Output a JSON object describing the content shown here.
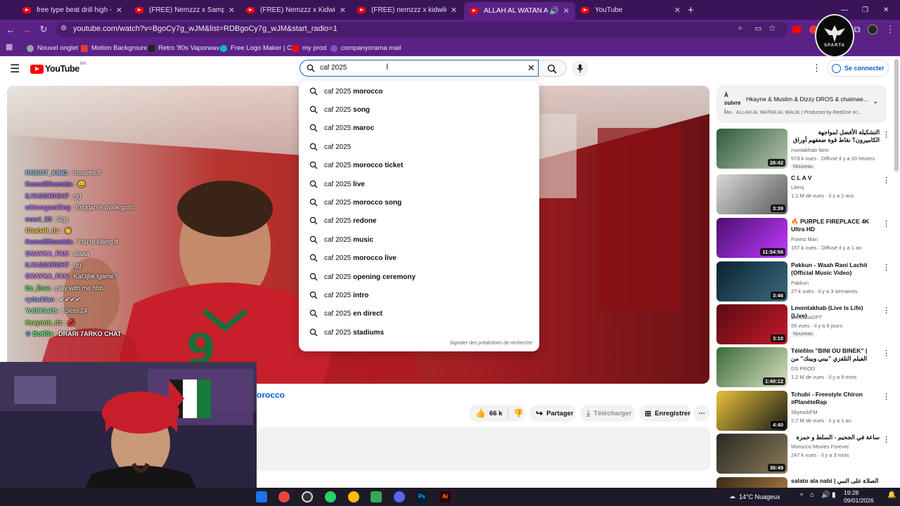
{
  "tabs": [
    {
      "label": "free type beat drill high - YouTube",
      "active": false
    },
    {
      "label": "(FREE) Nemzzz x Sample x Hoody",
      "active": false
    },
    {
      "label": "(FREE) Nemzzz x Kidwild x Hoody",
      "active": false
    },
    {
      "label": "(FREE) nemzzz x kidwild type bea",
      "active": false
    },
    {
      "label": "ALLAH AL WATAN AL MALIK",
      "active": true
    },
    {
      "label": "YouTube",
      "active": false
    }
  ],
  "toolbar": {
    "url": "youtube.com/watch?v=BgoCy7g_wJM&list=RDBgoCy7g_wJM&start_radio=1",
    "icons": [
      "back-icon",
      "forward-icon",
      "reload-icon",
      "site-info-icon",
      "zoom-icon",
      "install-icon",
      "bookmark-star-icon",
      "extensions-icon",
      "profile-icon",
      "menu-icon"
    ]
  },
  "bookmarks": [
    {
      "label": "Nouvel onglet",
      "color": "#9aa0a6"
    },
    {
      "label": "Motion Background",
      "color": "#e53935"
    },
    {
      "label": "Retro '80s Vaporwav...",
      "color": "#222222"
    },
    {
      "label": "Free Logo Maker | C...",
      "color": "#00bcd4"
    },
    {
      "label": "my prod",
      "color": "#ff0000"
    },
    {
      "label": "companyorama mail",
      "color": "#7e57c2"
    }
  ],
  "overlay_badge": "SPARTA",
  "yt": {
    "logo": "YouTube",
    "region": "MA",
    "search_value": "caf 2025",
    "signin": "Se connecter",
    "accent": "#065fd4"
  },
  "suggestions": [
    {
      "prefix": "caf 2025",
      "suffix": " morocco"
    },
    {
      "prefix": "caf 2025",
      "suffix": " song"
    },
    {
      "prefix": "caf 2025",
      "suffix": " maroc"
    },
    {
      "prefix": "caf 2025",
      "suffix": ""
    },
    {
      "prefix": "caf 2025",
      "suffix": " morocco ticket"
    },
    {
      "prefix": "caf 2025",
      "suffix": " live"
    },
    {
      "prefix": "caf 2025",
      "suffix": " morocco song"
    },
    {
      "prefix": "caf 2025",
      "suffix": " redone"
    },
    {
      "prefix": "caf 2025",
      "suffix": " music"
    },
    {
      "prefix": "caf 2025",
      "suffix": " morocco live"
    },
    {
      "prefix": "caf 2025",
      "suffix": " opening ceremony"
    },
    {
      "prefix": "caf 2025",
      "suffix": " intro"
    },
    {
      "prefix": "caf 2025",
      "suffix": " en direct"
    },
    {
      "prefix": "caf 2025",
      "suffix": " stadiums"
    }
  ],
  "suggest_footer": "Signaler des prédictions de recherche",
  "chat": [
    {
      "user": "ROBOT_KING",
      "msg": "!roulette 8",
      "color": "#9ad0ff"
    },
    {
      "user": "KemalElhamida",
      "msg": "😀",
      "color": "#a070ff"
    },
    {
      "user": "ILYASSXRGH7",
      "msg": "gg",
      "color": "#b07dff"
    },
    {
      "user": "ultimogamiiing",
      "msg": "Endgame dyalk gold.",
      "color": "#c27dff"
    },
    {
      "user": "nouri_93",
      "msg": "Ggs",
      "color": "#8f8fff"
    },
    {
      "user": "Chaball_dz",
      "msg": "👏",
      "color": "#ffd24d"
    },
    {
      "user": "KemalElhamida",
      "msg": "You're killing It",
      "color": "#a070ff"
    },
    {
      "user": "SMAYKA_FAN",
      "msg": "alaaa",
      "color": "#c88aff"
    },
    {
      "user": "ILYASSXRGH7",
      "msg": "gg",
      "color": "#b07dff"
    },
    {
      "user": "SMAYKA_FAN",
      "msg": "Kat3jbk lgame?",
      "color": "#c88aff"
    },
    {
      "user": "Dz_Eraa",
      "msg": "play with me hbb",
      "color": "#5cff5c"
    },
    {
      "user": "rydarkfan",
      "msg": "✔✔✔✔",
      "color": "#8fa8ff"
    },
    {
      "user": "YoDiiGaUs",
      "msg": "!Slots 24",
      "color": "#7dffb0"
    },
    {
      "user": "itsayoub_dz",
      "msg": "💋",
      "color": "#a7e85c"
    },
    {
      "user": "BotRix",
      "msg": "DRARI 7ARKO CHAT",
      "color": "#5cff7a"
    }
  ],
  "video": {
    "title_fragment": "orocco"
  },
  "actions": {
    "likes": "66 k",
    "share": "Partager",
    "download": "Télécharger",
    "save": "Enregistrer"
  },
  "upnext": {
    "label": "À suivre :",
    "title": "Hkayne & Muslim & Dizzy DROS & chaimae...",
    "subtitle": "Mix - ALLAH AL WATAN AL MALIK | Produced by RedOne #c..."
  },
  "recs": [
    {
      "title": "التشكيلة الأفضل لمواجهة الكاميرون؟ نقاط قوة ضعفهم أوراق دخرجوهم و دورو!؟",
      "channel": "montakhab fans",
      "stats": "579 k vues · Diffusé il y a 20 heures",
      "badge": "Nouveau",
      "duration": "28:42",
      "c1": "#2e5a3a",
      "c2": "#b8c7b0"
    },
    {
      "title": "C L A V",
      "channel": "Lbenj",
      "stats": "1,1 M de vues · il y a 2 ans",
      "badge": "",
      "duration": "3:39",
      "c1": "#d9d9d9",
      "c2": "#5a5a5a"
    },
    {
      "title": "🔥 PURPLE FIREPLACE 4K Ultra HD",
      "channel": "Forest Man",
      "stats": "157 k vues · Diffusé il y a 1 an",
      "badge": "",
      "duration": "11:54:56",
      "c1": "#4a0f6e",
      "c2": "#c23cff"
    },
    {
      "title": "Pakkun - Waah Rani Lachit (Official Music Video)",
      "channel": "Pakkun",
      "stats": "27 k vues · il y a 3 semaines",
      "badge": "",
      "duration": "3:46",
      "c1": "#0a2230",
      "c2": "#3a6b7e"
    },
    {
      "title": "Lmontakhab (Live Is Life) (Live)",
      "channel": "MoroccoGPT",
      "stats": "56 vues · il y a 6 jours",
      "badge": "Nouveau",
      "duration": "3:10",
      "c1": "#5a0a12",
      "c2": "#c21a2a"
    },
    {
      "title": "Téléfilm \"BINI OU BINEK\" | الفيلم التلفزي \"بيني وبينك\" من إخراج ادريس",
      "channel": "DS PROD",
      "stats": "1,2 M de vues · il y a 9 mois",
      "badge": "",
      "duration": "1:40:12",
      "c1": "#3a6b3a",
      "c2": "#d9e0c0"
    },
    {
      "title": "Tchubi - Freestyle Chiron #PlanèteRap",
      "channel": "SkyrockFM",
      "stats": "2,7 M de vues · il y a 1 an",
      "badge": "",
      "duration": "4:40",
      "c1": "#e8c23a",
      "c2": "#1a1a1a"
    },
    {
      "title": "ساعة في الجحيم - السلط و حمزة",
      "channel": "Morocco Movies Forever",
      "stats": "247 k vues · il y a 3 mois",
      "badge": "",
      "duration": "36:49",
      "c1": "#2a2a22",
      "c2": "#8a7a5a"
    },
    {
      "title": "salato ala nabi | الصلاة على النبي -",
      "channel": "",
      "stats": "",
      "badge": "",
      "duration": "",
      "c1": "#3a2a1a",
      "c2": "#c08a4a"
    }
  ],
  "taskbar": {
    "weather": "14°C Nuageux",
    "time": "19:28",
    "date": "09/01/2026",
    "apps": [
      {
        "name": "outlook-icon",
        "color": "#1a73e8"
      },
      {
        "name": "chrome-icon",
        "color": "#e8453c"
      },
      {
        "name": "obs-icon",
        "color": "#333333"
      },
      {
        "name": "whatsapp-icon",
        "color": "#25d366"
      },
      {
        "name": "chrome-icon-2",
        "color": "#fbbc04"
      },
      {
        "name": "play-icon",
        "color": "#34a853"
      },
      {
        "name": "discord-icon",
        "color": "#5865f2"
      },
      {
        "name": "photoshop-icon",
        "color": "#001e36"
      },
      {
        "name": "illustrator-icon",
        "color": "#330000"
      }
    ]
  }
}
